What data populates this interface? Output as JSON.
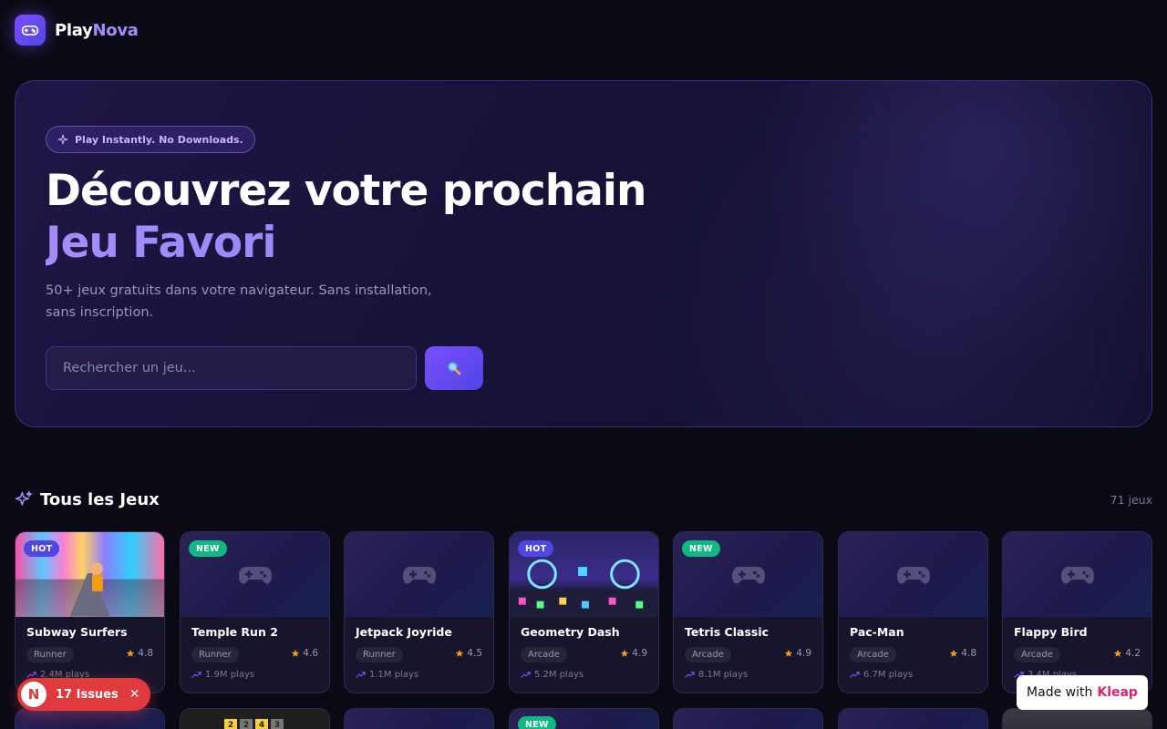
{
  "brand": {
    "part1": "Play",
    "part2": "Nova"
  },
  "hero": {
    "pill": "Play Instantly. No Downloads.",
    "title_line1": "Découvrez votre prochain",
    "title_line2": "Jeu Favori",
    "description": "50+ jeux gratuits dans votre navigateur. Sans installation, sans inscription.",
    "search_placeholder": "Rechercher un jeu...",
    "search_icon": "magnifier-icon"
  },
  "section": {
    "title": "Tous les Jeux",
    "count": "71 jeux"
  },
  "games": [
    {
      "title": "Subway Surfers",
      "genre": "Runner",
      "rating": "4.8",
      "plays": "2.4M plays",
      "badge": "HOT",
      "thumb": "image"
    },
    {
      "title": "Temple Run 2",
      "genre": "Runner",
      "rating": "4.6",
      "plays": "1.9M plays",
      "badge": "NEW",
      "thumb": "gamepad"
    },
    {
      "title": "Jetpack Joyride",
      "genre": "Runner",
      "rating": "4.5",
      "plays": "1.1M plays",
      "badge": "",
      "thumb": "gamepad"
    },
    {
      "title": "Geometry Dash",
      "genre": "Arcade",
      "rating": "4.9",
      "plays": "5.2M plays",
      "badge": "HOT",
      "thumb": "image"
    },
    {
      "title": "Tetris Classic",
      "genre": "Arcade",
      "rating": "4.9",
      "plays": "8.1M plays",
      "badge": "NEW",
      "thumb": "gamepad"
    },
    {
      "title": "Pac-Man",
      "genre": "Arcade",
      "rating": "4.8",
      "plays": "6.7M plays",
      "badge": "",
      "thumb": "gamepad"
    },
    {
      "title": "Flappy Bird",
      "genre": "Arcade",
      "rating": "4.2",
      "plays": "3.4M plays",
      "badge": "",
      "thumb": "gamepad"
    }
  ],
  "row2_badges": [
    "",
    "",
    "",
    "NEW",
    "",
    "",
    ""
  ],
  "row2_tiles": [
    "2",
    "2",
    "4",
    "3"
  ],
  "issues": {
    "count_label": "17 Issues",
    "avatar_letter": "N"
  },
  "made_with": {
    "prefix": "Made with",
    "brand": "Kleap"
  },
  "colors": {
    "accent": "#7c4dff",
    "hot": "#4f46e5",
    "new": "#10b981",
    "star": "#f59e0b",
    "issues": "#e0393e",
    "kleap": "#e11d74"
  }
}
